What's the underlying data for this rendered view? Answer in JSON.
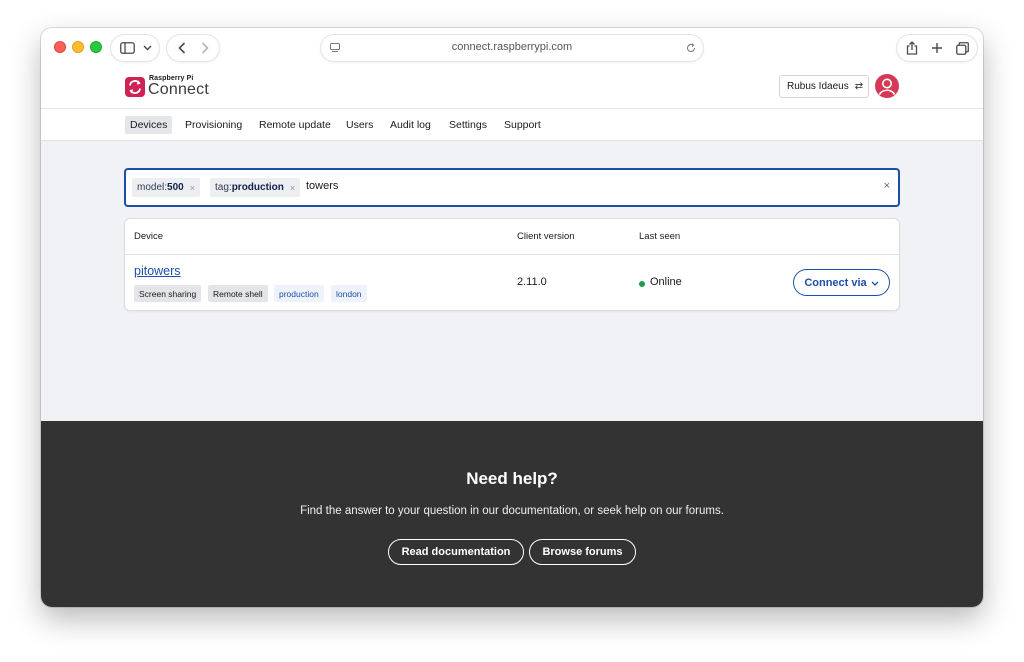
{
  "browser": {
    "url": "connect.raspberrypi.com",
    "icons": [
      "sidebar-icon",
      "chevron-down-icon",
      "back-icon",
      "forward-icon",
      "reader-icon",
      "reload-icon",
      "share-icon",
      "new-tab-icon",
      "tabs-overview-icon"
    ]
  },
  "header": {
    "logo_small": "Raspberry Pi",
    "logo_big": "Connect",
    "user_name": "Rubus Idaeus",
    "swap_icon": "⇄"
  },
  "nav": {
    "items": [
      {
        "label": "Devices"
      },
      {
        "label": "Provisioning"
      },
      {
        "label": "Remote update"
      },
      {
        "label": "Users"
      },
      {
        "label": "Audit log"
      },
      {
        "label": "Settings"
      },
      {
        "label": "Support"
      }
    ],
    "active": "Devices"
  },
  "search": {
    "filters": [
      {
        "key": "model:",
        "value": "500",
        "remove": "×"
      },
      {
        "key": "tag:",
        "value": "production",
        "remove": "×"
      }
    ],
    "query": "towers",
    "clear": "×"
  },
  "table": {
    "columns": [
      "Device",
      "Client version",
      "Last seen"
    ],
    "rows": [
      {
        "device": "pitowers",
        "capabilities": [
          "Screen sharing",
          "Remote shell"
        ],
        "tags": [
          "production",
          "london"
        ],
        "client_version": "2.11.0",
        "status": "Online",
        "action": "Connect via",
        "action_chevron": "⌄"
      }
    ]
  },
  "footer": {
    "title": "Need help?",
    "text": "Find the answer to your question in our documentation, or seek help on our forums.",
    "buttons": [
      {
        "label": "Read documentation"
      },
      {
        "label": "Browse forums"
      }
    ]
  },
  "colors": {
    "brand": "#cd2355",
    "link": "#1d4ea8",
    "online": "#1f9d4c",
    "footer_bg": "#333333"
  }
}
